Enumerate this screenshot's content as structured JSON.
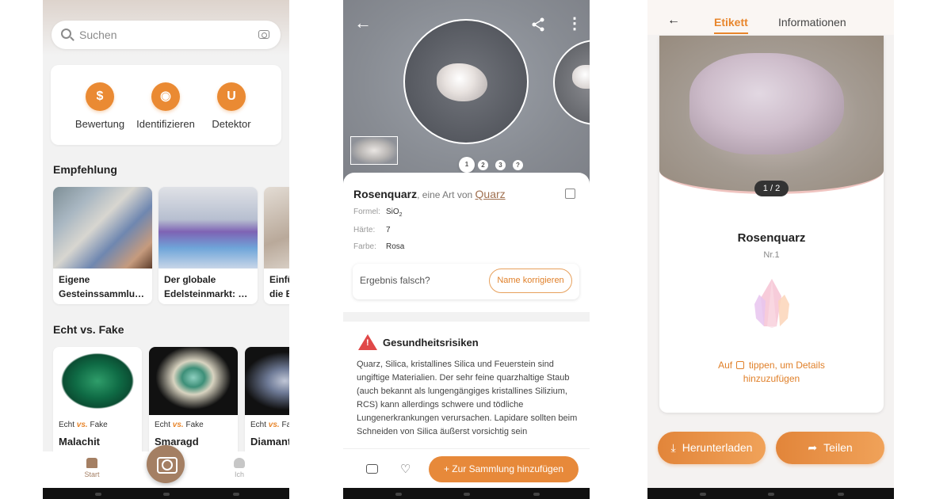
{
  "home": {
    "search_placeholder": "Suchen",
    "tools": [
      {
        "icon": "dollar-coin-icon",
        "glyph": "$",
        "label": "Bewertung"
      },
      {
        "icon": "camera-icon",
        "glyph": "◉",
        "label": "Identifizieren"
      },
      {
        "icon": "magnet-icon",
        "glyph": "U",
        "label": "Detektor"
      }
    ],
    "recommendation_title": "Empfehlung",
    "recommendations": [
      {
        "title_line1": "Eigene",
        "title_line2": "Gesteinssammlun…"
      },
      {
        "title_line1": "Der globale",
        "title_line2": "Edelsteinmarkt: Ei…"
      },
      {
        "title_line1": "Einfü",
        "title_line2": "die B"
      }
    ],
    "real_vs_fake_title": "Echt vs. Fake",
    "fake_cards": [
      {
        "prefix": "Echt",
        "vs": "vs.",
        "suffix": "Fake",
        "name": "Malachit"
      },
      {
        "prefix": "Echt",
        "vs": "vs.",
        "suffix": "Fake",
        "name": "Smaragd"
      },
      {
        "prefix": "Echt",
        "vs": "vs.",
        "suffix": "Fa",
        "name": "Diamant"
      }
    ],
    "tab_start": "Start",
    "tab_me": "Ich",
    "accent_color": "#e8862c"
  },
  "detail": {
    "pager_dots": [
      "1",
      "2",
      "3",
      "?"
    ],
    "name": "Rosenquarz",
    "kind_text": ", eine Art von ",
    "kind_link": "Quarz",
    "props": [
      {
        "label": "Formel:",
        "value": "SiO",
        "sub": "2"
      },
      {
        "label": "Härte:",
        "value": "7",
        "sub": ""
      },
      {
        "label": "Farbe:",
        "value": "Rosa",
        "sub": ""
      }
    ],
    "wrong_question": "Ergebnis falsch?",
    "correct_button": "Name korrigieren",
    "risk_title": "Gesundheitsrisiken",
    "risk_text": "Quarz, Silica, kristallines Silica und Feuerstein sind ungiftige Materialien. Der sehr feine quarzhaltige Staub (auch bekannt als lungengängiges kristallines Silizium, RCS) kann allerdings schwere und tödliche Lungenerkrankungen verursachen. Lapidare sollten beim Schneiden von Silica äußerst vorsichtig sein",
    "add_button": "+ Zur Sammlung hinzufügen"
  },
  "label": {
    "tab_label": "Etikett",
    "tab_info": "Informationen",
    "pager": "1 / 2",
    "name": "Rosenquarz",
    "number": "Nr.1",
    "hint_before": "Auf",
    "hint_after": "tippen, um Details",
    "hint_line2": "hinzuzufügen",
    "download_button": "Herunterladen",
    "share_button": "Teilen"
  }
}
